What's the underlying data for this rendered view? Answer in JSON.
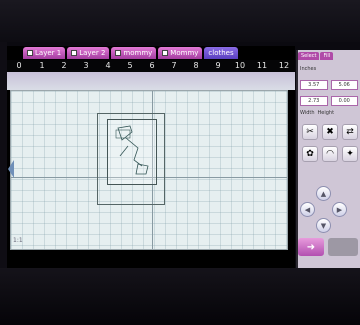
{
  "window": {
    "tabs": [
      {
        "label": "Layer 1"
      },
      {
        "label": "Layer 2"
      },
      {
        "label": "mommy"
      },
      {
        "label": "Mommy"
      },
      {
        "label": "clothes"
      }
    ]
  },
  "ruler": {
    "ticks": [
      "0",
      "1",
      "2",
      "3",
      "4",
      "5",
      "6",
      "7",
      "8",
      "9",
      "10",
      "11",
      "12"
    ]
  },
  "canvas": {
    "footer_text": "1:1"
  },
  "side_panel": {
    "tabs": [
      "Select",
      "Fill"
    ],
    "tab_labels": [
      "Select",
      "Fill"
    ],
    "width_value": "3.57",
    "height_value": "5.06",
    "x_value": "2.73",
    "y_value": "0.00",
    "width_label": "Width",
    "height_label": "Height",
    "unit_text": "Inches"
  },
  "icons": {
    "weld": "weld-icon",
    "delete": "delete-icon",
    "flip": "flip-icon",
    "group": "group-icon",
    "shadow": "shadow-icon",
    "figure": "figure-icon",
    "up": "arrow-up-icon",
    "down": "arrow-down-icon",
    "left": "arrow-left-icon",
    "right": "arrow-right-icon",
    "go": "arrow-right-icon"
  }
}
